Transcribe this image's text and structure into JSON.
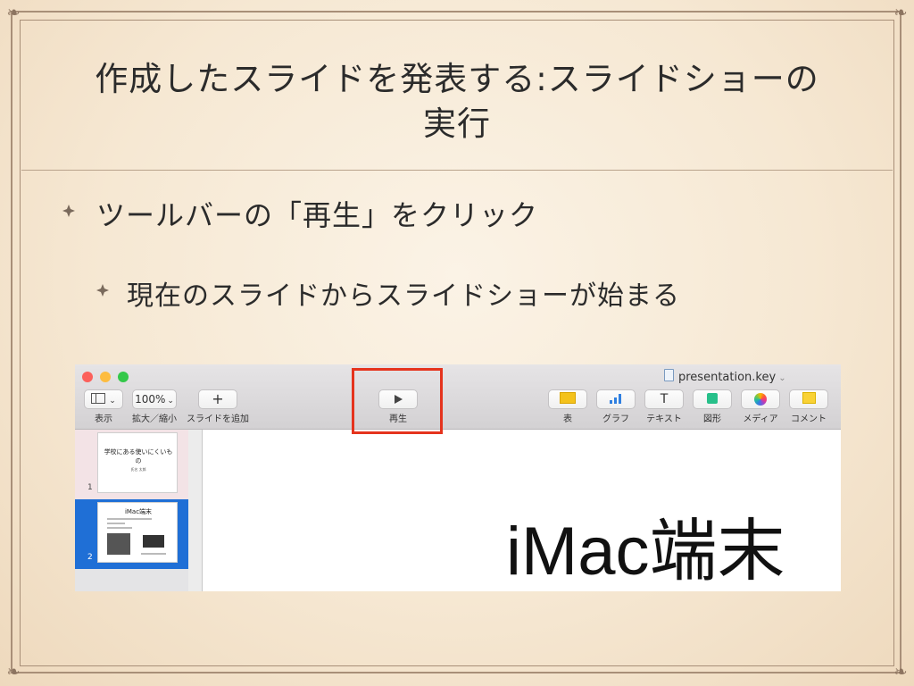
{
  "slide": {
    "title_line1": "作成したスライドを発表する:スライドショーの",
    "title_line2": "実行",
    "bullet1": "ツールバーの「再生」をクリック",
    "bullet2": "現在のスライドからスライドショーが始まる"
  },
  "keynote": {
    "document_name": "presentation.key",
    "toolbar": {
      "view_label": "表示",
      "zoom_value": "100%",
      "zoom_label": "拡大／縮小",
      "add_slide_label": "スライドを追加",
      "play_label": "再生",
      "table_label": "表",
      "chart_label": "グラフ",
      "text_label": "テキスト",
      "shape_label": "図形",
      "media_label": "メディア",
      "comment_label": "コメント"
    },
    "navigator": {
      "slides": [
        {
          "number": "1",
          "title": "学校にある使いにくいもの",
          "subtitle": "氏名 太郎"
        },
        {
          "number": "2",
          "title": "iMac端末",
          "selected": true
        }
      ]
    },
    "canvas_text": "iMac端末"
  },
  "colors": {
    "highlight": "#e5331d",
    "selection": "#1f6fd6"
  }
}
